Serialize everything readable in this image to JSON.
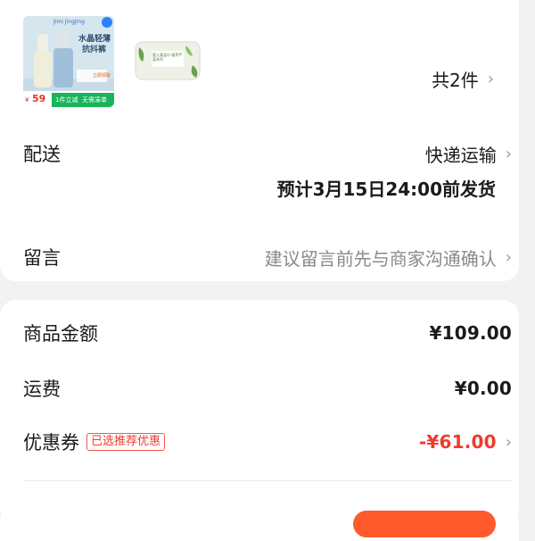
{
  "products": {
    "thumb1": {
      "brand": "Jimi JingJing",
      "title_line1": "水晶轻薄",
      "title_line2": "抗抖裤",
      "price_symbol": "¥",
      "price": "59",
      "promo": "1件立减",
      "promo2": "无需凑单",
      "corner_tag": "立即领取"
    },
    "thumb2": {
      "title": "婴儿柔湿巾 植萃芦荟系列"
    },
    "count_label": "共2件"
  },
  "shipping": {
    "label": "配送",
    "method": "快递运输",
    "eta": "预计3月15日24:00前发货"
  },
  "message": {
    "label": "留言",
    "placeholder": "建议留言前先与商家沟通确认"
  },
  "summary": {
    "goods_label": "商品金额",
    "goods_amount": "¥109.00",
    "shipping_label": "运费",
    "shipping_amount": "¥0.00",
    "coupon_label": "优惠券",
    "coupon_tag": "已选推荐优惠",
    "coupon_amount": "-¥61.00"
  },
  "colors": {
    "accent": "#f03a2e",
    "pay_button": "#ff5a2c",
    "background": "#f2f2f2"
  }
}
